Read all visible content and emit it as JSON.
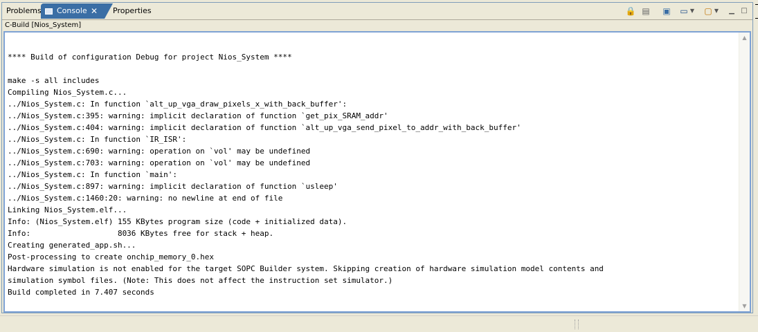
{
  "tabs": [
    {
      "label": "Problems",
      "icon": "problems-icon"
    },
    {
      "label": "Console",
      "icon": "console-icon"
    },
    {
      "label": "Properties",
      "icon": "properties-icon"
    }
  ],
  "toolbar": {
    "icons": [
      "scroll-lock-icon",
      "clear-console-icon",
      "pin-console-icon",
      "display-console-icon",
      "chevron-down-icon",
      "open-console-icon",
      "chevron-down-icon",
      "minimize-icon",
      "maximize-icon"
    ]
  },
  "console": {
    "title": "C-Build [Nios_System]",
    "lines": [
      "",
      "**** Build of configuration Debug for project Nios_System ****",
      "",
      "make -s all includes",
      "Compiling Nios_System.c...",
      "../Nios_System.c: In function `alt_up_vga_draw_pixels_x_with_back_buffer':",
      "../Nios_System.c:395: warning: implicit declaration of function `get_pix_SRAM_addr'",
      "../Nios_System.c:404: warning: implicit declaration of function `alt_up_vga_send_pixel_to_addr_with_back_buffer'",
      "../Nios_System.c: In function `IR_ISR':",
      "../Nios_System.c:690: warning: operation on `vol' may be undefined",
      "../Nios_System.c:703: warning: operation on `vol' may be undefined",
      "../Nios_System.c: In function `main':",
      "../Nios_System.c:897: warning: implicit declaration of function `usleep'",
      "../Nios_System.c:1460:20: warning: no newline at end of file",
      "Linking Nios_System.elf...",
      "Info: (Nios_System.elf) 155 KBytes program size (code + initialized data).",
      "Info:                   8036 KBytes free for stack + heap.",
      "Creating generated_app.sh...",
      "Post-processing to create onchip_memory_0.hex",
      "Hardware simulation is not enabled for the target SOPC Builder system. Skipping creation of hardware simulation model contents and",
      "simulation symbol files. (Note: This does not affect the instruction set simulator.)",
      "Build completed in 7.407 seconds"
    ]
  }
}
